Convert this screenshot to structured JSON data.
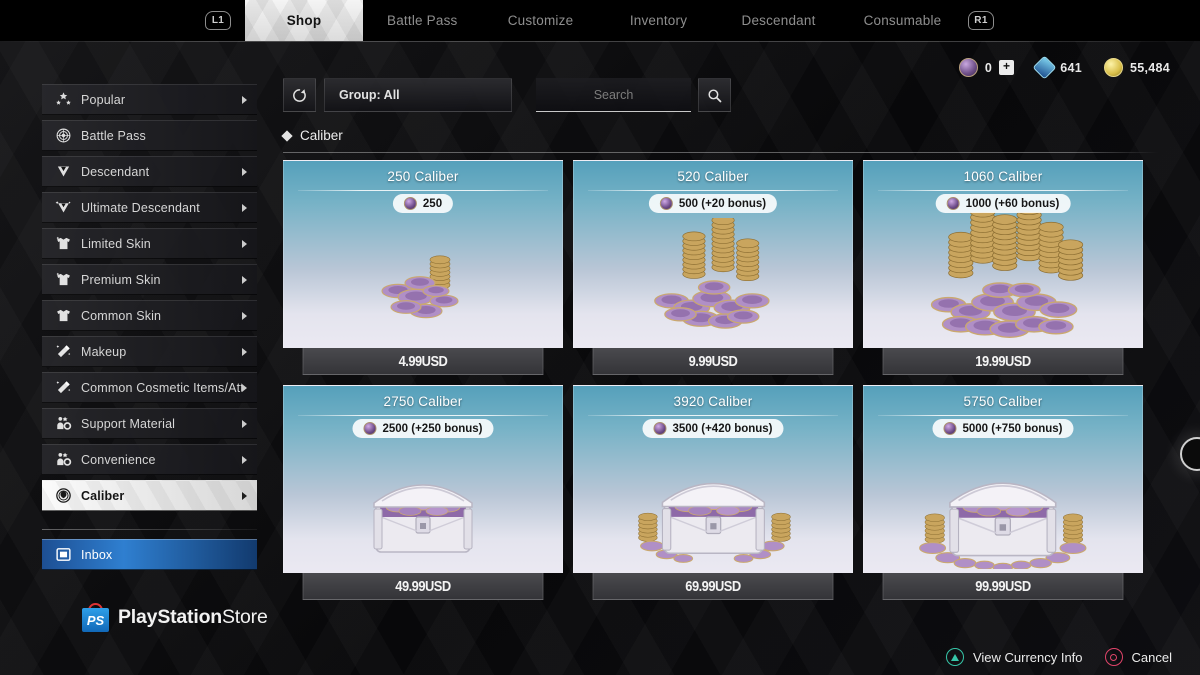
{
  "topnav": {
    "left_shoulder": "L1",
    "right_shoulder": "R1",
    "tabs": [
      {
        "label": "Shop",
        "active": true
      },
      {
        "label": "Battle Pass",
        "active": false
      },
      {
        "label": "Customize",
        "active": false
      },
      {
        "label": "Inventory",
        "active": false
      },
      {
        "label": "Descendant",
        "active": false
      },
      {
        "label": "Consumable",
        "active": false
      }
    ]
  },
  "currency": {
    "caliber": {
      "icon": "caliber-coin-icon",
      "value": "0",
      "add_label": "+"
    },
    "gem": {
      "icon": "gem-icon",
      "value": "641"
    },
    "gold": {
      "icon": "gold-coin-icon",
      "value": "55,484"
    }
  },
  "sidebar": {
    "items": [
      {
        "label": "Popular",
        "icon": "stars-icon",
        "chevron": true,
        "selected": false
      },
      {
        "label": "Battle Pass",
        "icon": "battle-pass-icon",
        "chevron": false,
        "selected": false
      },
      {
        "label": "Descendant",
        "icon": "descendant-icon",
        "chevron": true,
        "selected": false
      },
      {
        "label": "Ultimate Descendant",
        "icon": "ultimate-descendant-icon",
        "chevron": true,
        "selected": false
      },
      {
        "label": "Limited Skin",
        "icon": "shirt-sparkle-icon",
        "chevron": true,
        "selected": false
      },
      {
        "label": "Premium Skin",
        "icon": "shirt-sparkle-icon",
        "chevron": true,
        "selected": false
      },
      {
        "label": "Common Skin",
        "icon": "shirt-icon",
        "chevron": true,
        "selected": false
      },
      {
        "label": "Makeup",
        "icon": "wand-icon",
        "chevron": true,
        "selected": false
      },
      {
        "label": "Common Cosmetic Items/Atta",
        "icon": "wand-icon",
        "chevron": true,
        "selected": false
      },
      {
        "label": "Support Material",
        "icon": "support-material-icon",
        "chevron": true,
        "selected": false
      },
      {
        "label": "Convenience",
        "icon": "support-material-icon",
        "chevron": true,
        "selected": false
      },
      {
        "label": "Caliber",
        "icon": "caliber-emblem-icon",
        "chevron": true,
        "selected": true
      }
    ],
    "inbox": {
      "label": "Inbox",
      "icon": "inbox-icon"
    },
    "store_logo": {
      "brand": "PlayStation",
      "suffix": "Store",
      "icon": "playstation-bag-icon"
    }
  },
  "toolbar": {
    "refresh_icon": "refresh-icon",
    "group_label": "Group: All",
    "search_placeholder": "Search",
    "search_value": "",
    "search_icon": "magnifier-icon"
  },
  "section": {
    "title": "Caliber",
    "bullet_icon": "diamond-icon"
  },
  "products": [
    {
      "title": "250 Caliber",
      "amount": "250",
      "price": "4.99USD",
      "art": "coins-small"
    },
    {
      "title": "520 Caliber",
      "amount": "500 (+20 bonus)",
      "price": "9.99USD",
      "art": "coins-medium"
    },
    {
      "title": "1060 Caliber",
      "amount": "1000 (+60 bonus)",
      "price": "19.99USD",
      "art": "coins-large"
    },
    {
      "title": "2750 Caliber",
      "amount": "2500 (+250 bonus)",
      "price": "49.99USD",
      "art": "chest-small"
    },
    {
      "title": "3920 Caliber",
      "amount": "3500 (+420 bonus)",
      "price": "69.99USD",
      "art": "chest-medium"
    },
    {
      "title": "5750 Caliber",
      "amount": "5000 (+750 bonus)",
      "price": "99.99USD",
      "art": "chest-large"
    }
  ],
  "hints": [
    {
      "button": "triangle",
      "label": "View Currency Info",
      "color": "#36c6a8"
    },
    {
      "button": "circle",
      "label": "Cancel",
      "color": "#e0446a"
    }
  ]
}
